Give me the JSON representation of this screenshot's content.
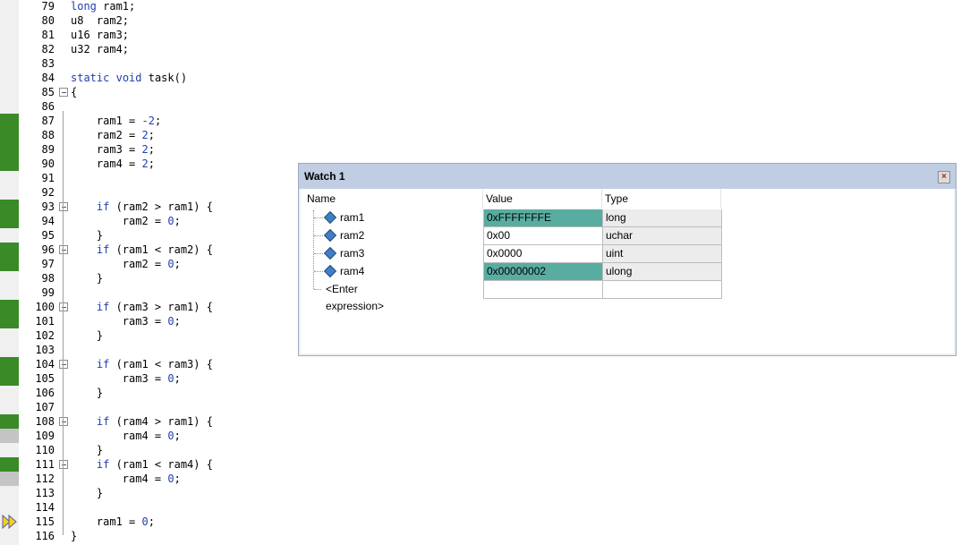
{
  "editor": {
    "lines": [
      {
        "num": "79",
        "code": "long ram1;",
        "cov": "",
        "fold": false
      },
      {
        "num": "80",
        "code": "u8  ram2;",
        "cov": "",
        "fold": false
      },
      {
        "num": "81",
        "code": "u16 ram3;",
        "cov": "",
        "fold": false
      },
      {
        "num": "82",
        "code": "u32 ram4;",
        "cov": "",
        "fold": false
      },
      {
        "num": "83",
        "code": "",
        "cov": "",
        "fold": false
      },
      {
        "num": "84",
        "code": "static void task()",
        "cov": "",
        "fold": false
      },
      {
        "num": "85",
        "code": "{",
        "cov": "",
        "fold": true
      },
      {
        "num": "86",
        "code": "",
        "cov": "",
        "fold": false
      },
      {
        "num": "87",
        "code": "    ram1 = -2;",
        "cov": "green",
        "fold": false
      },
      {
        "num": "88",
        "code": "    ram2 = 2;",
        "cov": "green",
        "fold": false
      },
      {
        "num": "89",
        "code": "    ram3 = 2;",
        "cov": "green",
        "fold": false
      },
      {
        "num": "90",
        "code": "    ram4 = 2;",
        "cov": "green",
        "fold": false
      },
      {
        "num": "91",
        "code": "",
        "cov": "",
        "fold": false
      },
      {
        "num": "92",
        "code": "",
        "cov": "",
        "fold": false
      },
      {
        "num": "93",
        "code": "    if (ram2 > ram1) {",
        "cov": "green",
        "fold": true
      },
      {
        "num": "94",
        "code": "        ram2 = 0;",
        "cov": "green",
        "fold": false
      },
      {
        "num": "95",
        "code": "    }",
        "cov": "",
        "fold": false
      },
      {
        "num": "96",
        "code": "    if (ram1 < ram2) {",
        "cov": "green",
        "fold": true
      },
      {
        "num": "97",
        "code": "        ram2 = 0;",
        "cov": "green",
        "fold": false
      },
      {
        "num": "98",
        "code": "    }",
        "cov": "",
        "fold": false
      },
      {
        "num": "99",
        "code": "",
        "cov": "",
        "fold": false
      },
      {
        "num": "100",
        "code": "    if (ram3 > ram1) {",
        "cov": "green",
        "fold": true
      },
      {
        "num": "101",
        "code": "        ram3 = 0;",
        "cov": "green",
        "fold": false
      },
      {
        "num": "102",
        "code": "    }",
        "cov": "",
        "fold": false
      },
      {
        "num": "103",
        "code": "",
        "cov": "",
        "fold": false
      },
      {
        "num": "104",
        "code": "    if (ram1 < ram3) {",
        "cov": "green",
        "fold": true
      },
      {
        "num": "105",
        "code": "        ram3 = 0;",
        "cov": "green",
        "fold": false
      },
      {
        "num": "106",
        "code": "    }",
        "cov": "",
        "fold": false
      },
      {
        "num": "107",
        "code": "",
        "cov": "",
        "fold": false
      },
      {
        "num": "108",
        "code": "    if (ram4 > ram1) {",
        "cov": "green",
        "fold": true
      },
      {
        "num": "109",
        "code": "        ram4 = 0;",
        "cov": "gray",
        "fold": false
      },
      {
        "num": "110",
        "code": "    }",
        "cov": "",
        "fold": false
      },
      {
        "num": "111",
        "code": "    if (ram1 < ram4) {",
        "cov": "green",
        "fold": true
      },
      {
        "num": "112",
        "code": "        ram4 = 0;",
        "cov": "gray",
        "fold": false
      },
      {
        "num": "113",
        "code": "    }",
        "cov": "",
        "fold": false
      },
      {
        "num": "114",
        "code": "",
        "cov": "",
        "fold": false
      },
      {
        "num": "115",
        "code": "    ram1 = 0;",
        "cov": "",
        "fold": false
      },
      {
        "num": "116",
        "code": "}",
        "cov": "",
        "fold": false
      }
    ],
    "keywords": [
      "long",
      "static",
      "void",
      "if"
    ],
    "current_line_marker": "execution-arrow-icon"
  },
  "watch": {
    "title": "Watch 1",
    "close_icon": "close-icon",
    "columns": {
      "name": "Name",
      "value": "Value",
      "type": "Type"
    },
    "rows": [
      {
        "name": "ram1",
        "value": "0xFFFFFFFE",
        "type": "long",
        "changed": true
      },
      {
        "name": "ram2",
        "value": "0x00",
        "type": "uchar",
        "changed": false
      },
      {
        "name": "ram3",
        "value": "0x0000",
        "type": "uint",
        "changed": false
      },
      {
        "name": "ram4",
        "value": "0x00000002",
        "type": "ulong",
        "changed": true
      }
    ],
    "enter_expression": "<Enter expression>"
  },
  "colors": {
    "coverage_executed": "#3a8a27",
    "coverage_not_executed": "#c4c4c4",
    "changed_value": "#59ada0",
    "keyword": "#1f3fae",
    "watch_title_bar": "#c0cde2"
  }
}
